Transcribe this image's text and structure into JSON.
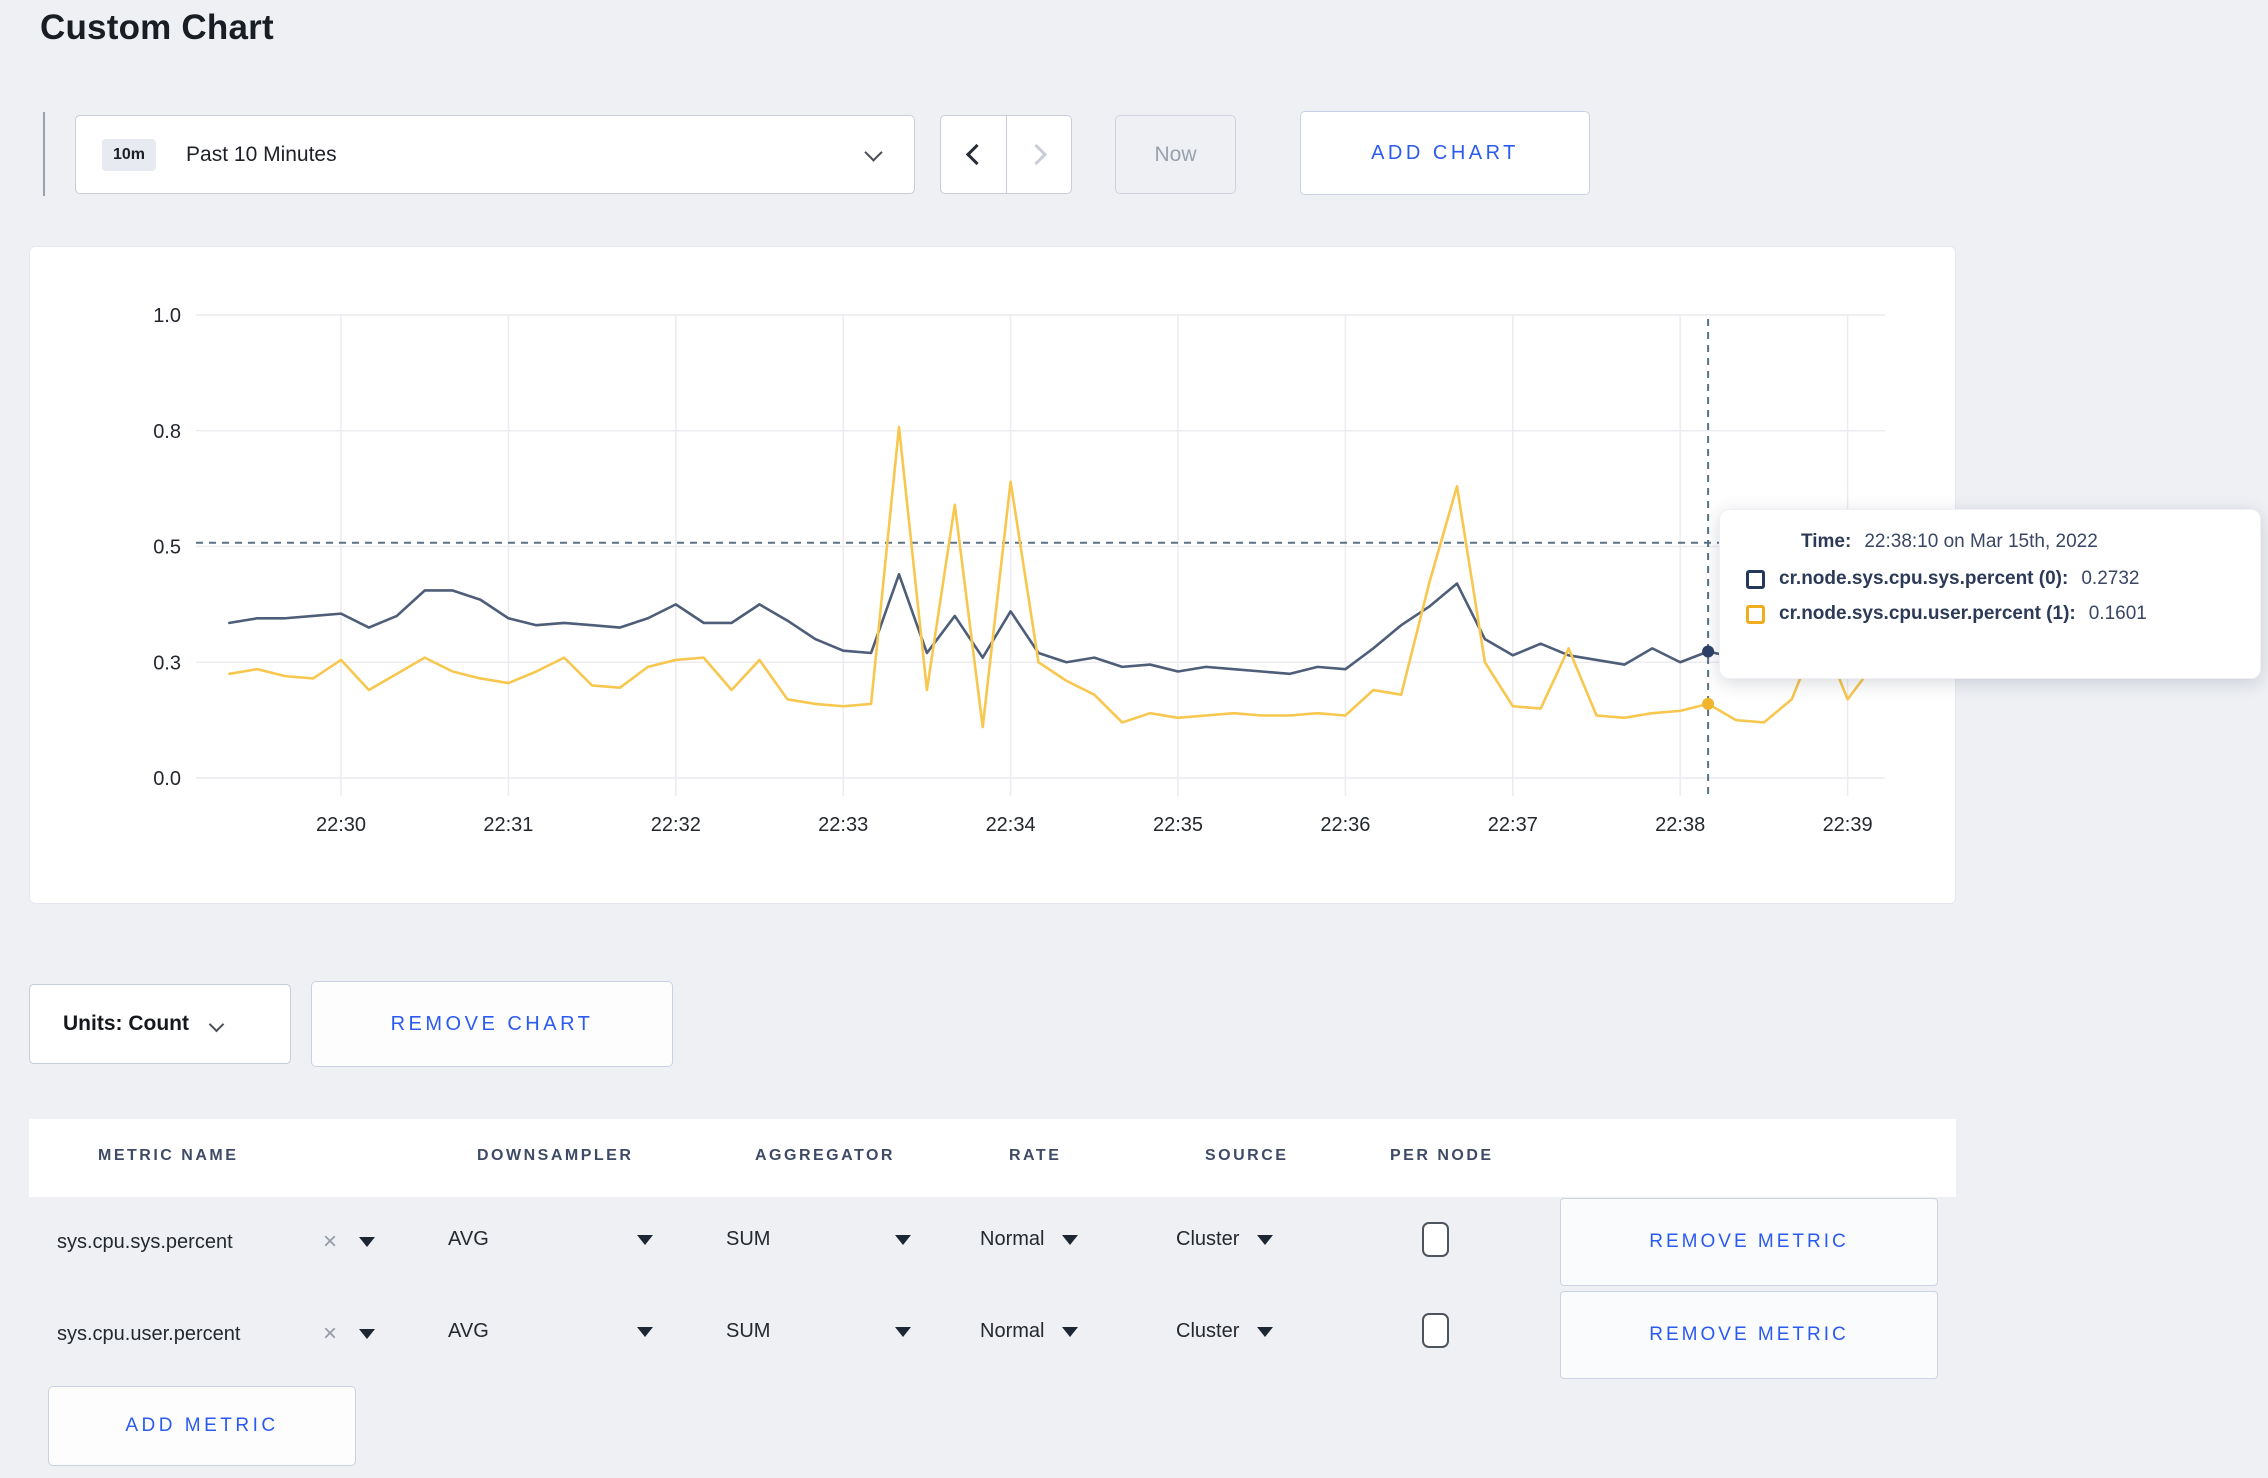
{
  "page": {
    "title": "Custom Chart",
    "accent_blue": "#2b5af0",
    "background": "#eef0f4"
  },
  "toolbar": {
    "time_range_badge": "10m",
    "time_range_label": "Past 10 Minutes",
    "now_label": "Now",
    "add_chart_label": "ADD CHART"
  },
  "icons": {
    "time_dropdown_caret": "chevron-down",
    "time_back": "chevron-left",
    "time_forward": "chevron-right",
    "units_caret": "chevron-down",
    "select_caret": "triangle-down",
    "clear_glyph": "×"
  },
  "chart_data": {
    "type": "line",
    "title": "",
    "xlabel": "",
    "ylabel": "",
    "ylim": [
      0,
      1
    ],
    "grid": true,
    "x_ticks": [
      "22:30",
      "22:31",
      "22:32",
      "22:33",
      "22:34",
      "22:35",
      "22:36",
      "22:37",
      "22:38",
      "22:39"
    ],
    "y_ticks": {
      "labels": [
        "0.0",
        "0.3",
        "0.5",
        "0.8",
        "1.0"
      ],
      "values": [
        0,
        0.25,
        0.5,
        0.75,
        1.0
      ]
    },
    "x": [
      "22:29:20",
      "22:29:30",
      "22:29:40",
      "22:29:50",
      "22:30:00",
      "22:30:10",
      "22:30:20",
      "22:30:30",
      "22:30:40",
      "22:30:50",
      "22:31:00",
      "22:31:10",
      "22:31:20",
      "22:31:30",
      "22:31:40",
      "22:31:50",
      "22:32:00",
      "22:32:10",
      "22:32:20",
      "22:32:30",
      "22:32:40",
      "22:32:50",
      "22:33:00",
      "22:33:10",
      "22:33:20",
      "22:33:30",
      "22:33:40",
      "22:33:50",
      "22:34:00",
      "22:34:10",
      "22:34:20",
      "22:34:30",
      "22:34:40",
      "22:34:50",
      "22:35:00",
      "22:35:10",
      "22:35:20",
      "22:35:30",
      "22:35:40",
      "22:35:50",
      "22:36:00",
      "22:36:10",
      "22:36:20",
      "22:36:30",
      "22:36:40",
      "22:36:50",
      "22:37:00",
      "22:37:10",
      "22:37:20",
      "22:37:30",
      "22:37:40",
      "22:37:50",
      "22:38:00",
      "22:38:10",
      "22:38:20",
      "22:38:30",
      "22:38:40",
      "22:38:50",
      "22:39:00",
      "22:39:10"
    ],
    "series": [
      {
        "name": "cr.node.sys.cpu.sys.percent",
        "color": "#4e5d78",
        "dot_color": "#2c4166",
        "values": [
          0.335,
          0.345,
          0.345,
          0.35,
          0.355,
          0.325,
          0.35,
          0.405,
          0.405,
          0.385,
          0.345,
          0.33,
          0.335,
          0.33,
          0.325,
          0.345,
          0.375,
          0.335,
          0.335,
          0.375,
          0.34,
          0.3,
          0.275,
          0.27,
          0.44,
          0.27,
          0.35,
          0.26,
          0.36,
          0.27,
          0.25,
          0.26,
          0.24,
          0.245,
          0.23,
          0.24,
          0.235,
          0.23,
          0.225,
          0.24,
          0.235,
          0.28,
          0.33,
          0.37,
          0.42,
          0.3,
          0.265,
          0.29,
          0.265,
          0.255,
          0.245,
          0.28,
          0.25,
          0.2732,
          0.26,
          0.27,
          0.28,
          0.27,
          0.265,
          0.27
        ]
      },
      {
        "name": "cr.node.sys.cpu.user.percent",
        "color": "#f7c74f",
        "dot_color": "#f0b42e",
        "values": [
          0.225,
          0.235,
          0.22,
          0.215,
          0.255,
          0.19,
          0.225,
          0.26,
          0.23,
          0.215,
          0.205,
          0.23,
          0.26,
          0.2,
          0.195,
          0.24,
          0.255,
          0.26,
          0.19,
          0.255,
          0.17,
          0.16,
          0.155,
          0.16,
          0.758,
          0.19,
          0.59,
          0.11,
          0.64,
          0.25,
          0.21,
          0.18,
          0.12,
          0.14,
          0.13,
          0.135,
          0.14,
          0.135,
          0.135,
          0.14,
          0.135,
          0.19,
          0.18,
          0.42,
          0.63,
          0.25,
          0.155,
          0.15,
          0.28,
          0.135,
          0.13,
          0.14,
          0.145,
          0.1601,
          0.125,
          0.12,
          0.17,
          0.32,
          0.17,
          0.25
        ]
      }
    ],
    "crosshair": {
      "x_index": 53,
      "time": "22:38:10",
      "threshold_value": 0.508
    },
    "legend_position": "tooltip"
  },
  "tooltip": {
    "time_label": "Time:",
    "time_value": "22:38:10 on Mar 15th, 2022",
    "series": [
      {
        "name": "cr.node.sys.cpu.sys.percent (0):",
        "value": "0.2732",
        "color": "#24385e"
      },
      {
        "name": "cr.node.sys.cpu.user.percent (1):",
        "value": "0.1601",
        "color": "#f0ad1f"
      }
    ]
  },
  "chart_footer": {
    "units_label": "Units: Count",
    "remove_chart_label": "REMOVE CHART"
  },
  "metrics_table": {
    "headers": [
      "METRIC NAME",
      "DOWNSAMPLER",
      "AGGREGATOR",
      "RATE",
      "SOURCE",
      "PER NODE"
    ],
    "rows": [
      {
        "metric": "sys.cpu.sys.percent",
        "downsampler": "AVG",
        "aggregator": "SUM",
        "rate": "Normal",
        "source": "Cluster",
        "per_node_checked": false,
        "remove_label": "REMOVE METRIC"
      },
      {
        "metric": "sys.cpu.user.percent",
        "downsampler": "AVG",
        "aggregator": "SUM",
        "rate": "Normal",
        "source": "Cluster",
        "per_node_checked": false,
        "remove_label": "REMOVE METRIC"
      }
    ],
    "add_metric_label": "ADD METRIC"
  }
}
